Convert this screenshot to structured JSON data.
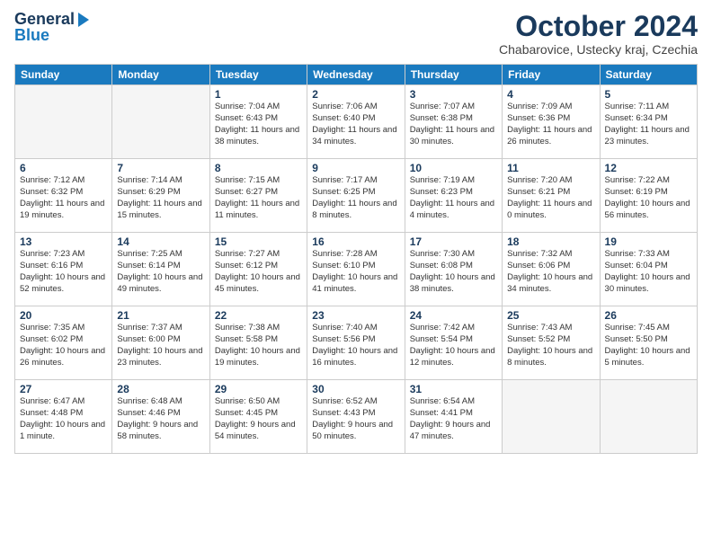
{
  "header": {
    "logo_general": "General",
    "logo_blue": "Blue",
    "month_title": "October 2024",
    "subtitle": "Chabarovice, Ustecky kraj, Czechia"
  },
  "days_of_week": [
    "Sunday",
    "Monday",
    "Tuesday",
    "Wednesday",
    "Thursday",
    "Friday",
    "Saturday"
  ],
  "weeks": [
    [
      {
        "day": "",
        "info": ""
      },
      {
        "day": "",
        "info": ""
      },
      {
        "day": "1",
        "info": "Sunrise: 7:04 AM\nSunset: 6:43 PM\nDaylight: 11 hours\nand 38 minutes."
      },
      {
        "day": "2",
        "info": "Sunrise: 7:06 AM\nSunset: 6:40 PM\nDaylight: 11 hours\nand 34 minutes."
      },
      {
        "day": "3",
        "info": "Sunrise: 7:07 AM\nSunset: 6:38 PM\nDaylight: 11 hours\nand 30 minutes."
      },
      {
        "day": "4",
        "info": "Sunrise: 7:09 AM\nSunset: 6:36 PM\nDaylight: 11 hours\nand 26 minutes."
      },
      {
        "day": "5",
        "info": "Sunrise: 7:11 AM\nSunset: 6:34 PM\nDaylight: 11 hours\nand 23 minutes."
      }
    ],
    [
      {
        "day": "6",
        "info": "Sunrise: 7:12 AM\nSunset: 6:32 PM\nDaylight: 11 hours\nand 19 minutes."
      },
      {
        "day": "7",
        "info": "Sunrise: 7:14 AM\nSunset: 6:29 PM\nDaylight: 11 hours\nand 15 minutes."
      },
      {
        "day": "8",
        "info": "Sunrise: 7:15 AM\nSunset: 6:27 PM\nDaylight: 11 hours\nand 11 minutes."
      },
      {
        "day": "9",
        "info": "Sunrise: 7:17 AM\nSunset: 6:25 PM\nDaylight: 11 hours\nand 8 minutes."
      },
      {
        "day": "10",
        "info": "Sunrise: 7:19 AM\nSunset: 6:23 PM\nDaylight: 11 hours\nand 4 minutes."
      },
      {
        "day": "11",
        "info": "Sunrise: 7:20 AM\nSunset: 6:21 PM\nDaylight: 11 hours\nand 0 minutes."
      },
      {
        "day": "12",
        "info": "Sunrise: 7:22 AM\nSunset: 6:19 PM\nDaylight: 10 hours\nand 56 minutes."
      }
    ],
    [
      {
        "day": "13",
        "info": "Sunrise: 7:23 AM\nSunset: 6:16 PM\nDaylight: 10 hours\nand 52 minutes."
      },
      {
        "day": "14",
        "info": "Sunrise: 7:25 AM\nSunset: 6:14 PM\nDaylight: 10 hours\nand 49 minutes."
      },
      {
        "day": "15",
        "info": "Sunrise: 7:27 AM\nSunset: 6:12 PM\nDaylight: 10 hours\nand 45 minutes."
      },
      {
        "day": "16",
        "info": "Sunrise: 7:28 AM\nSunset: 6:10 PM\nDaylight: 10 hours\nand 41 minutes."
      },
      {
        "day": "17",
        "info": "Sunrise: 7:30 AM\nSunset: 6:08 PM\nDaylight: 10 hours\nand 38 minutes."
      },
      {
        "day": "18",
        "info": "Sunrise: 7:32 AM\nSunset: 6:06 PM\nDaylight: 10 hours\nand 34 minutes."
      },
      {
        "day": "19",
        "info": "Sunrise: 7:33 AM\nSunset: 6:04 PM\nDaylight: 10 hours\nand 30 minutes."
      }
    ],
    [
      {
        "day": "20",
        "info": "Sunrise: 7:35 AM\nSunset: 6:02 PM\nDaylight: 10 hours\nand 26 minutes."
      },
      {
        "day": "21",
        "info": "Sunrise: 7:37 AM\nSunset: 6:00 PM\nDaylight: 10 hours\nand 23 minutes."
      },
      {
        "day": "22",
        "info": "Sunrise: 7:38 AM\nSunset: 5:58 PM\nDaylight: 10 hours\nand 19 minutes."
      },
      {
        "day": "23",
        "info": "Sunrise: 7:40 AM\nSunset: 5:56 PM\nDaylight: 10 hours\nand 16 minutes."
      },
      {
        "day": "24",
        "info": "Sunrise: 7:42 AM\nSunset: 5:54 PM\nDaylight: 10 hours\nand 12 minutes."
      },
      {
        "day": "25",
        "info": "Sunrise: 7:43 AM\nSunset: 5:52 PM\nDaylight: 10 hours\nand 8 minutes."
      },
      {
        "day": "26",
        "info": "Sunrise: 7:45 AM\nSunset: 5:50 PM\nDaylight: 10 hours\nand 5 minutes."
      }
    ],
    [
      {
        "day": "27",
        "info": "Sunrise: 6:47 AM\nSunset: 4:48 PM\nDaylight: 10 hours\nand 1 minute."
      },
      {
        "day": "28",
        "info": "Sunrise: 6:48 AM\nSunset: 4:46 PM\nDaylight: 9 hours\nand 58 minutes."
      },
      {
        "day": "29",
        "info": "Sunrise: 6:50 AM\nSunset: 4:45 PM\nDaylight: 9 hours\nand 54 minutes."
      },
      {
        "day": "30",
        "info": "Sunrise: 6:52 AM\nSunset: 4:43 PM\nDaylight: 9 hours\nand 50 minutes."
      },
      {
        "day": "31",
        "info": "Sunrise: 6:54 AM\nSunset: 4:41 PM\nDaylight: 9 hours\nand 47 minutes."
      },
      {
        "day": "",
        "info": ""
      },
      {
        "day": "",
        "info": ""
      }
    ]
  ]
}
